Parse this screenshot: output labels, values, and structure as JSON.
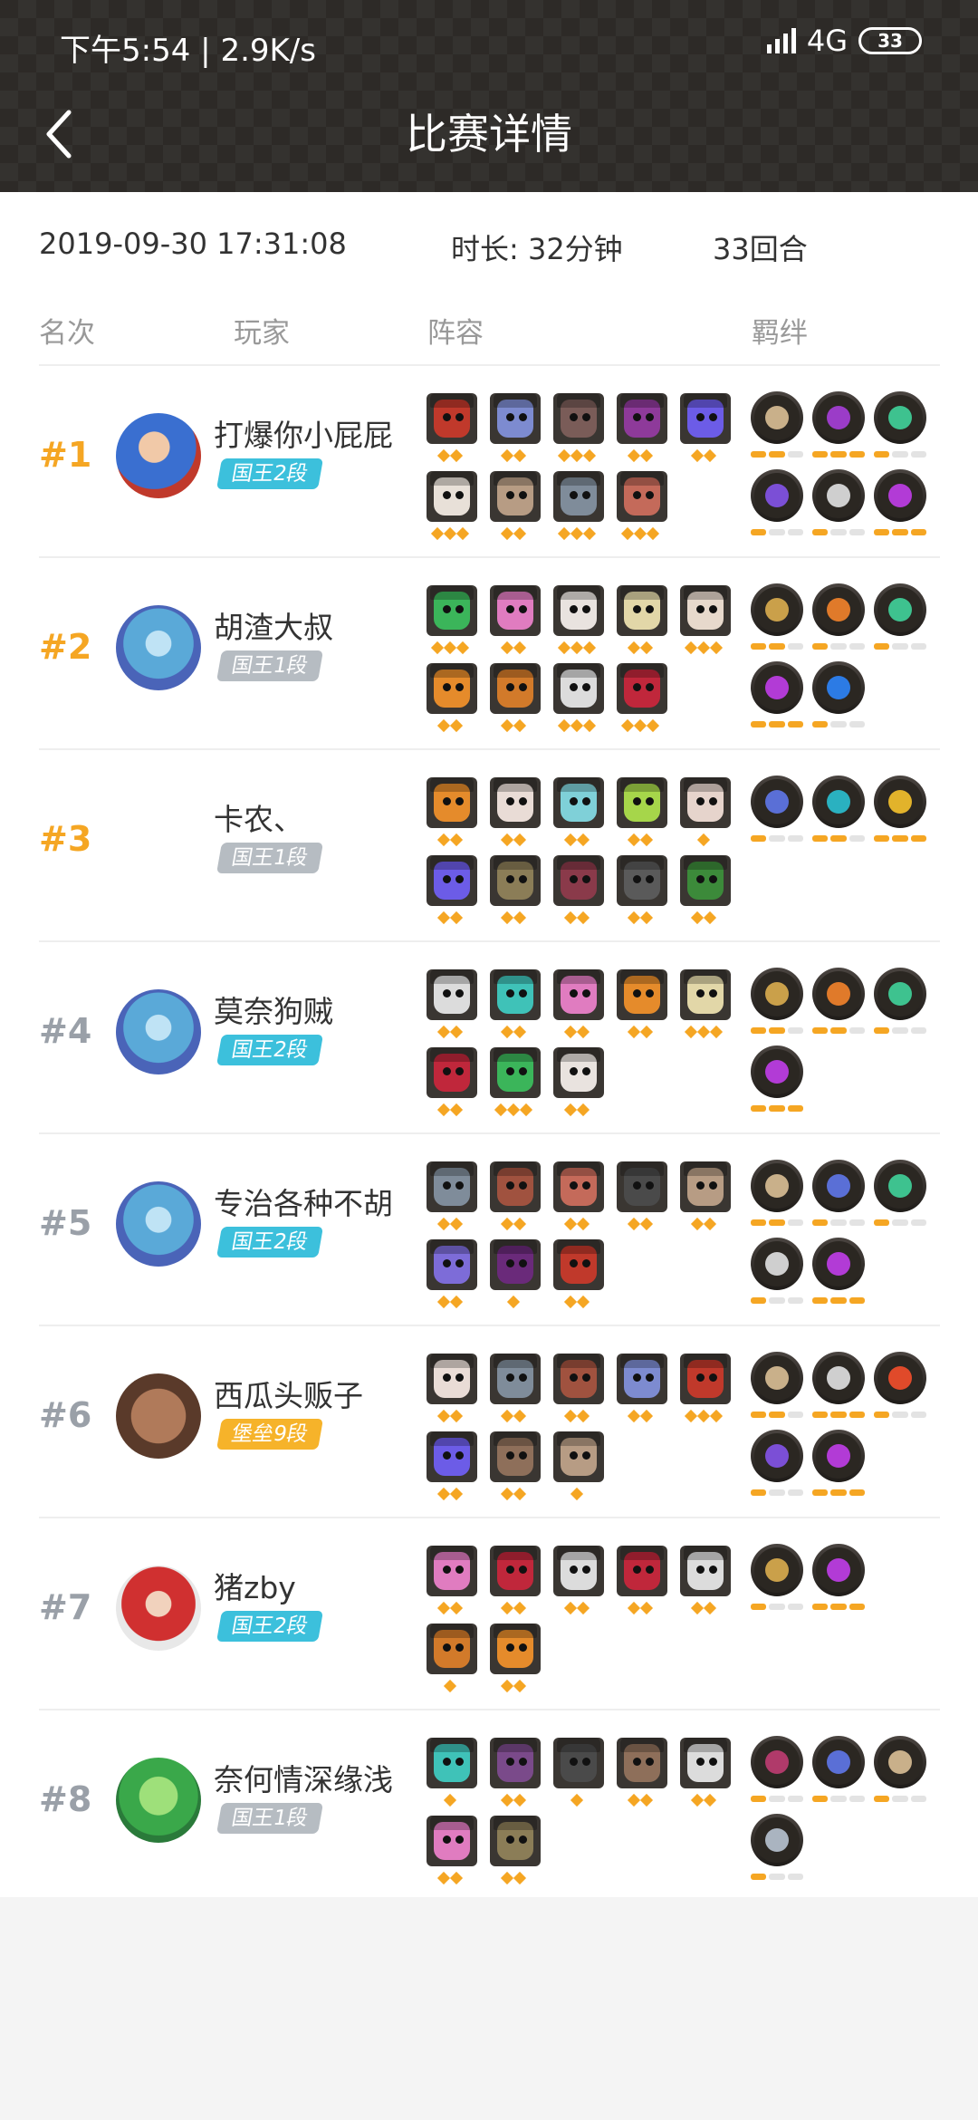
{
  "status_bar": {
    "time": "下午5:54",
    "speed": "2.9K/s",
    "network": "4G",
    "battery": "33"
  },
  "header": {
    "title": "比赛详情"
  },
  "match": {
    "datetime": "2019-09-30 17:31:08",
    "duration": "时长: 32分钟",
    "rounds": "33回合"
  },
  "columns": {
    "rank": "名次",
    "player": "玩家",
    "lineup": "阵容",
    "traits": "羁绊"
  },
  "colors": {
    "gold_rank": "#f5a623",
    "grey_rank": "#9aa0a8",
    "king_badge": "#3cc0dc",
    "king_badge_grey": "#b6bcc2",
    "fort_badge": "#f6b32a",
    "star": "#f5a623"
  },
  "players": [
    {
      "rank": "#1",
      "name": "打爆你小屁屁",
      "badge": "国王2段",
      "badge_type": "king",
      "avatar": "blue-hero",
      "top": true,
      "units": [
        {
          "c": "#c0392b",
          "s": 2
        },
        {
          "c": "#7d8bd0",
          "s": 2
        },
        {
          "c": "#7a5c58",
          "s": 3
        },
        {
          "c": "#8e3a9a",
          "s": 2
        },
        {
          "c": "#6c5ce7",
          "s": 2
        },
        {
          "c": "#e8e0d8",
          "s": 3
        },
        {
          "c": "#b79c84",
          "s": 2
        },
        {
          "c": "#7f8c9a",
          "s": 3
        },
        {
          "c": "#c46a5a",
          "s": 3
        }
      ],
      "traits": [
        {
          "c": "#c9b08a",
          "b": [
            2,
            3
          ]
        },
        {
          "c": "#9b3cc8",
          "b": [
            3,
            3
          ]
        },
        {
          "c": "#3ec28f",
          "b": [
            1,
            3
          ]
        },
        {
          "c": "#7b4fd6",
          "b": [
            1,
            3
          ]
        },
        {
          "c": "#cfcfcf",
          "b": [
            1,
            3
          ]
        },
        {
          "c": "#b23bd6",
          "b": [
            3,
            3
          ]
        }
      ]
    },
    {
      "rank": "#2",
      "name": "胡渣大叔",
      "badge": "国王1段",
      "badge_type": "king-grey",
      "avatar": "blue-dragon",
      "top": true,
      "units": [
        {
          "c": "#3bb55a",
          "s": 3
        },
        {
          "c": "#e07cc0",
          "s": 2
        },
        {
          "c": "#e9e3df",
          "s": 3
        },
        {
          "c": "#e2d7a8",
          "s": 2
        },
        {
          "c": "#e7d9cc",
          "s": 3
        },
        {
          "c": "#e58b2b",
          "s": 2
        },
        {
          "c": "#d27a2a",
          "s": 2
        },
        {
          "c": "#dcdcdc",
          "s": 3
        },
        {
          "c": "#c0273b",
          "s": 3
        }
      ],
      "traits": [
        {
          "c": "#caa04a",
          "b": [
            2,
            3
          ]
        },
        {
          "c": "#e07a2a",
          "b": [
            1,
            3
          ]
        },
        {
          "c": "#3ec28f",
          "b": [
            1,
            3
          ]
        },
        {
          "c": "#b23bd6",
          "b": [
            3,
            3
          ]
        },
        {
          "c": "#2c7be5",
          "b": [
            1,
            3
          ]
        }
      ]
    },
    {
      "rank": "#3",
      "name": "卡农、",
      "badge": "国王1段",
      "badge_type": "king-grey",
      "avatar": "",
      "top": true,
      "units": [
        {
          "c": "#e58b2b",
          "s": 2
        },
        {
          "c": "#e9dcd6",
          "s": 2
        },
        {
          "c": "#7fd0d8",
          "s": 2
        },
        {
          "c": "#a6d64a",
          "s": 2
        },
        {
          "c": "#e6d4cc",
          "s": 1
        },
        {
          "c": "#6c5ce7",
          "s": 2
        },
        {
          "c": "#8b7d57",
          "s": 2
        },
        {
          "c": "#8a3a4a",
          "s": 2
        },
        {
          "c": "#5a5a5a",
          "s": 2
        },
        {
          "c": "#3c8a3a",
          "s": 2
        }
      ],
      "traits": [
        {
          "c": "#5a6fd6",
          "b": [
            1,
            3
          ]
        },
        {
          "c": "#2ab1c0",
          "b": [
            2,
            3
          ]
        },
        {
          "c": "#e2b32b",
          "b": [
            3,
            3
          ]
        }
      ]
    },
    {
      "rank": "#4",
      "name": "莫奈狗贼",
      "badge": "国王2段",
      "badge_type": "king",
      "avatar": "blue-dragon",
      "top": false,
      "units": [
        {
          "c": "#dcdcdc",
          "s": 2
        },
        {
          "c": "#3fc2b8",
          "s": 2
        },
        {
          "c": "#e07cc0",
          "s": 2
        },
        {
          "c": "#e58b2b",
          "s": 2
        },
        {
          "c": "#e2d7a8",
          "s": 3
        },
        {
          "c": "#c0273b",
          "s": 2
        },
        {
          "c": "#3bb55a",
          "s": 3
        },
        {
          "c": "#e9e3df",
          "s": 2
        }
      ],
      "traits": [
        {
          "c": "#caa04a",
          "b": [
            2,
            3
          ]
        },
        {
          "c": "#e07a2a",
          "b": [
            2,
            3
          ]
        },
        {
          "c": "#3ec28f",
          "b": [
            1,
            3
          ]
        },
        {
          "c": "#b23bd6",
          "b": [
            3,
            3
          ]
        }
      ]
    },
    {
      "rank": "#5",
      "name": "专治各种不胡",
      "badge": "国王2段",
      "badge_type": "king",
      "avatar": "blue-dragon",
      "top": false,
      "units": [
        {
          "c": "#7f8c9a",
          "s": 2
        },
        {
          "c": "#a0523f",
          "s": 2
        },
        {
          "c": "#c46a5a",
          "s": 2
        },
        {
          "c": "#4a4a4a",
          "s": 2
        },
        {
          "c": "#b79c84",
          "s": 2
        },
        {
          "c": "#7d6cd8",
          "s": 2
        },
        {
          "c": "#6a2a7a",
          "s": 1
        },
        {
          "c": "#c0392b",
          "s": 2
        }
      ],
      "traits": [
        {
          "c": "#c9b08a",
          "b": [
            2,
            3
          ]
        },
        {
          "c": "#5a6fd6",
          "b": [
            1,
            3
          ]
        },
        {
          "c": "#3ec28f",
          "b": [
            1,
            3
          ]
        },
        {
          "c": "#cfcfcf",
          "b": [
            1,
            3
          ]
        },
        {
          "c": "#b23bd6",
          "b": [
            3,
            3
          ]
        }
      ]
    },
    {
      "rank": "#6",
      "name": "西瓜头贩子",
      "badge": "堡垒9段",
      "badge_type": "fort",
      "avatar": "brown-face",
      "top": false,
      "units": [
        {
          "c": "#e9dcd6",
          "s": 2
        },
        {
          "c": "#7f8c9a",
          "s": 2
        },
        {
          "c": "#a0523f",
          "s": 2
        },
        {
          "c": "#7d8bd0",
          "s": 2
        },
        {
          "c": "#c0392b",
          "s": 3
        },
        {
          "c": "#6c5ce7",
          "s": 2
        },
        {
          "c": "#8e6f5a",
          "s": 2
        },
        {
          "c": "#b79c84",
          "s": 1
        }
      ],
      "traits": [
        {
          "c": "#c9b08a",
          "b": [
            2,
            3
          ]
        },
        {
          "c": "#cfcfcf",
          "b": [
            3,
            3
          ]
        },
        {
          "c": "#e04a2a",
          "b": [
            1,
            3
          ]
        },
        {
          "c": "#7b4fd6",
          "b": [
            1,
            3
          ]
        },
        {
          "c": "#b23bd6",
          "b": [
            3,
            3
          ]
        }
      ]
    },
    {
      "rank": "#7",
      "name": "猪zby",
      "badge": "国王2段",
      "badge_type": "king",
      "avatar": "red-ninja",
      "top": false,
      "units": [
        {
          "c": "#e07cc0",
          "s": 2
        },
        {
          "c": "#c0273b",
          "s": 2
        },
        {
          "c": "#dcdcdc",
          "s": 2
        },
        {
          "c": "#c0273b",
          "s": 2
        },
        {
          "c": "#dcdcdc",
          "s": 2
        },
        {
          "c": "#d27a2a",
          "s": 1
        },
        {
          "c": "#e58b2b",
          "s": 2
        }
      ],
      "traits": [
        {
          "c": "#caa04a",
          "b": [
            1,
            3
          ]
        },
        {
          "c": "#b23bd6",
          "b": [
            3,
            3
          ]
        }
      ]
    },
    {
      "rank": "#8",
      "name": "奈何情深缘浅",
      "badge": "国王1段",
      "badge_type": "king-grey",
      "avatar": "green-orc",
      "top": false,
      "units": [
        {
          "c": "#3fc2b8",
          "s": 1
        },
        {
          "c": "#7a4a8a",
          "s": 2
        },
        {
          "c": "#4a4a4a",
          "s": 1
        },
        {
          "c": "#8e6f5a",
          "s": 2
        },
        {
          "c": "#dcdcdc",
          "s": 2
        },
        {
          "c": "#e07cc0",
          "s": 2
        },
        {
          "c": "#8b7d57",
          "s": 2
        }
      ],
      "traits": [
        {
          "c": "#b03a6a",
          "b": [
            1,
            3
          ]
        },
        {
          "c": "#5a6fd6",
          "b": [
            1,
            3
          ]
        },
        {
          "c": "#c9b08a",
          "b": [
            1,
            3
          ]
        },
        {
          "c": "#aab4c0",
          "b": [
            1,
            3
          ]
        }
      ]
    }
  ]
}
